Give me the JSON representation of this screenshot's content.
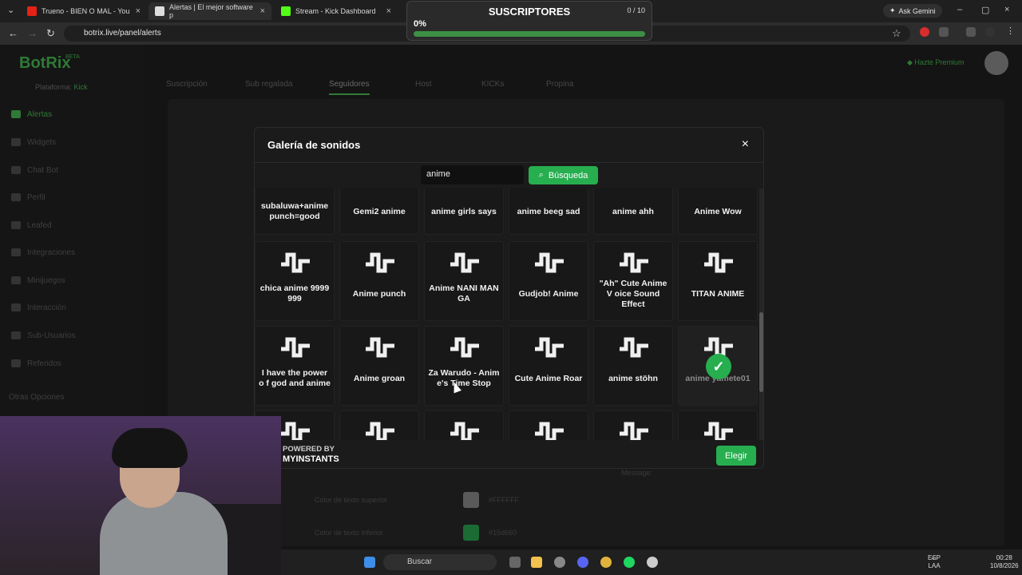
{
  "browser": {
    "tabs": [
      {
        "title": "Trueno - BIEN O MAL - You",
        "favicon_color": "#e62117"
      },
      {
        "title": "Alertas | El mejor software p",
        "favicon_color": "#dddddd"
      },
      {
        "title": "Stream - Kick Dashboard",
        "favicon_color": "#53fc18"
      }
    ],
    "ask_label": "Ask Gemini",
    "url": "botrix.live/panel/alerts"
  },
  "overlay": {
    "title": "SUSCRIPTORES",
    "count": "0 / 10",
    "percent_label": "0%",
    "progress_fraction": 0.0
  },
  "app": {
    "logo": "BotRix",
    "logo_badge": "BETA",
    "platform_label": "Plataforma:",
    "platform_value": "Kick",
    "sidebar": [
      {
        "label": "Alertas",
        "active": true
      },
      {
        "label": "Widgets"
      },
      {
        "label": "Chat Bot"
      },
      {
        "label": "Perfil"
      },
      {
        "label": "Leafed"
      },
      {
        "label": "Integraciones"
      },
      {
        "label": "Minijuegos"
      },
      {
        "label": "Interacción"
      },
      {
        "label": "Sub-Usuarios"
      },
      {
        "label": "Referidos"
      },
      {
        "label": "Otras Opciones"
      }
    ],
    "tabs": [
      "Suscripción",
      "Sub regalada",
      "Seguidores",
      "Host",
      "KICKs",
      "Propina"
    ],
    "active_tab": "Seguidores",
    "premium_label": "Hazte Premium",
    "dim_labels": {
      "top_text_color": "Color de texto superior",
      "top_text_value": "#FFFFFF",
      "bottom_text_color": "Color de texto inferior",
      "bottom_text_value": "#15d660",
      "message_label": "Message:"
    }
  },
  "modal": {
    "title": "Galería de sonidos",
    "search_value": "anime",
    "search_button": "Búsqueda",
    "sounds": [
      [
        "subaluwa+anime punch=good",
        "Gemi2 anime",
        "anime girls says",
        "anime beeg sad",
        "anime ahh",
        "Anime Wow"
      ],
      [
        "chica anime 9999 999",
        "Anime punch",
        "Anime NANI MAN GA",
        "Gudjob! Anime",
        "\"Ah\" Cute Anime V oice Sound Effect",
        "TITAN ANIME"
      ],
      [
        "I have the power o f god and anime",
        "Anime groan",
        "Za Warudo - Anim e's Time Stop",
        "Cute Anime Roar",
        "anime stöhn",
        "anime yamete01"
      ],
      [
        "",
        "",
        "",
        "",
        "",
        ""
      ]
    ],
    "selected_sound": "anime yamete01",
    "powered_by": "POWERED BY",
    "provider": "MYINSTANTS",
    "choose_button": "Elegir"
  },
  "taskbar": {
    "search_placeholder": "Buscar",
    "lang_top": "ESP",
    "lang_bottom": "LAA",
    "time": "00:28",
    "date": "10/8/2026"
  },
  "colors": {
    "accent": "#27ae4f"
  }
}
